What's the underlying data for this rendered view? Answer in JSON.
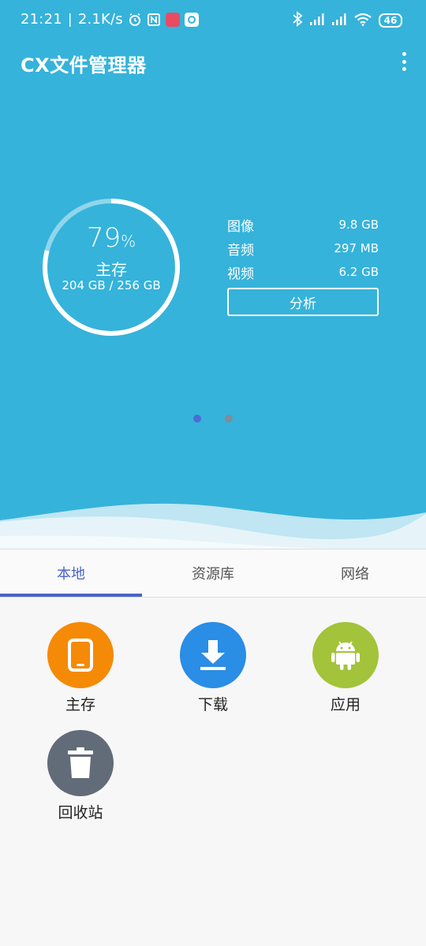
{
  "status_bar": {
    "time": "21:21",
    "net_speed": "2.1K/s",
    "battery": "46"
  },
  "app": {
    "title": "CX文件管理器"
  },
  "storage": {
    "percent_number": "79",
    "percent_sign": "%",
    "percent_used": 0.79,
    "label": "主存",
    "used_total": "204 GB / 256 GB"
  },
  "stats": [
    {
      "key": "图像",
      "value": "9.8 GB"
    },
    {
      "key": "音频",
      "value": "297 MB"
    },
    {
      "key": "视频",
      "value": "6.2 GB"
    }
  ],
  "analyze_label": "分析",
  "pager": {
    "pages": 2,
    "active": 1
  },
  "tabs": [
    {
      "label": "本地",
      "active": true
    },
    {
      "label": "资源库",
      "active": false
    },
    {
      "label": "网络",
      "active": false
    }
  ],
  "grid": [
    {
      "label": "主存",
      "icon": "tablet-icon",
      "color": "#f58a07"
    },
    {
      "label": "下载",
      "icon": "download-icon",
      "color": "#2a8de6"
    },
    {
      "label": "应用",
      "icon": "android-icon",
      "color": "#a3c33a"
    },
    {
      "label": "回收站",
      "icon": "trash-icon",
      "color": "#626c78"
    }
  ],
  "colors": {
    "hero": "#35b3da",
    "accent": "#4a63c6"
  }
}
